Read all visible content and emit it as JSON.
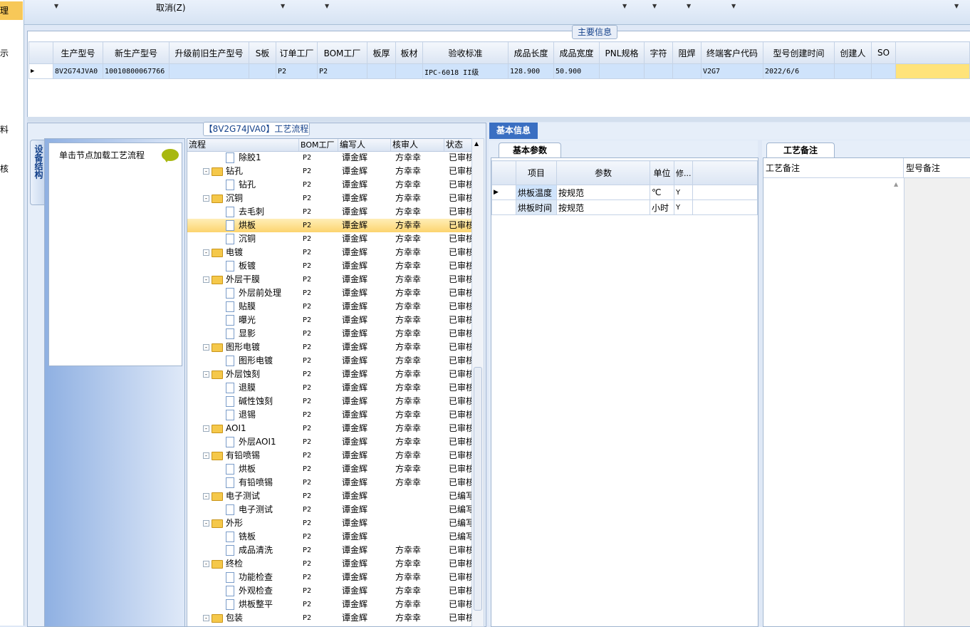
{
  "left_strip": {
    "items": [
      "理",
      "示",
      "料",
      "核"
    ]
  },
  "toolbar": {
    "cancel_label": "取消(Z)"
  },
  "main_info": {
    "title": "主要信息",
    "columns": [
      "生产型号",
      "新生产型号",
      "升级前旧生产型号",
      "S板",
      "订单工厂",
      "BOM工厂",
      "板厚",
      "板材",
      "验收标准",
      "成品长度",
      "成品宽度",
      "PNL规格",
      "字符",
      "阻焊",
      "终端客户代码",
      "型号创建时间",
      "创建人",
      "SO"
    ],
    "row": [
      "8V2G74JVA0",
      "10010800067766",
      "",
      "",
      "P2",
      "P2",
      "",
      "",
      "IPC-6018 II级",
      "128.900",
      "50.900",
      "",
      "",
      "",
      "V2G7",
      "2022/6/6",
      "",
      ""
    ]
  },
  "process": {
    "title": "【8V2G74JVA0】工艺流程",
    "vertical_tab": "设备结构",
    "node_hint": "单击节点加载工艺流程",
    "columns": [
      "流程",
      "BOM工厂",
      "编写人",
      "核审人",
      "状态"
    ],
    "rows": [
      {
        "name": "除胶1",
        "level": 2,
        "bom": "P2",
        "writer": "谭金辉",
        "reviewer": "方幸幸",
        "status": "已审核"
      },
      {
        "name": "钻孔",
        "level": 1,
        "bom": "P2",
        "writer": "谭金辉",
        "reviewer": "方幸幸",
        "status": "已审核"
      },
      {
        "name": "钻孔",
        "level": 2,
        "bom": "P2",
        "writer": "谭金辉",
        "reviewer": "方幸幸",
        "status": "已审核"
      },
      {
        "name": "沉铜",
        "level": 1,
        "bom": "P2",
        "writer": "谭金辉",
        "reviewer": "方幸幸",
        "status": "已审核"
      },
      {
        "name": "去毛刺",
        "level": 2,
        "bom": "P2",
        "writer": "谭金辉",
        "reviewer": "方幸幸",
        "status": "已审核"
      },
      {
        "name": "烘板",
        "level": 2,
        "bom": "P2",
        "writer": "谭金辉",
        "reviewer": "方幸幸",
        "status": "已审核",
        "selected": true
      },
      {
        "name": "沉铜",
        "level": 2,
        "bom": "P2",
        "writer": "谭金辉",
        "reviewer": "方幸幸",
        "status": "已审核"
      },
      {
        "name": "电镀",
        "level": 1,
        "bom": "P2",
        "writer": "谭金辉",
        "reviewer": "方幸幸",
        "status": "已审核"
      },
      {
        "name": "板镀",
        "level": 2,
        "bom": "P2",
        "writer": "谭金辉",
        "reviewer": "方幸幸",
        "status": "已审核"
      },
      {
        "name": "外层干膜",
        "level": 1,
        "bom": "P2",
        "writer": "谭金辉",
        "reviewer": "方幸幸",
        "status": "已审核"
      },
      {
        "name": "外层前处理",
        "level": 2,
        "bom": "P2",
        "writer": "谭金辉",
        "reviewer": "方幸幸",
        "status": "已审核"
      },
      {
        "name": "贴膜",
        "level": 2,
        "bom": "P2",
        "writer": "谭金辉",
        "reviewer": "方幸幸",
        "status": "已审核"
      },
      {
        "name": "曝光",
        "level": 2,
        "bom": "P2",
        "writer": "谭金辉",
        "reviewer": "方幸幸",
        "status": "已审核"
      },
      {
        "name": "显影",
        "level": 2,
        "bom": "P2",
        "writer": "谭金辉",
        "reviewer": "方幸幸",
        "status": "已审核"
      },
      {
        "name": "图形电镀",
        "level": 1,
        "bom": "P2",
        "writer": "谭金辉",
        "reviewer": "方幸幸",
        "status": "已审核"
      },
      {
        "name": "图形电镀",
        "level": 2,
        "bom": "P2",
        "writer": "谭金辉",
        "reviewer": "方幸幸",
        "status": "已审核"
      },
      {
        "name": "外层蚀刻",
        "level": 1,
        "bom": "P2",
        "writer": "谭金辉",
        "reviewer": "方幸幸",
        "status": "已审核"
      },
      {
        "name": "退膜",
        "level": 2,
        "bom": "P2",
        "writer": "谭金辉",
        "reviewer": "方幸幸",
        "status": "已审核"
      },
      {
        "name": "碱性蚀刻",
        "level": 2,
        "bom": "P2",
        "writer": "谭金辉",
        "reviewer": "方幸幸",
        "status": "已审核"
      },
      {
        "name": "退锡",
        "level": 2,
        "bom": "P2",
        "writer": "谭金辉",
        "reviewer": "方幸幸",
        "status": "已审核"
      },
      {
        "name": "AOI1",
        "level": 1,
        "bom": "P2",
        "writer": "谭金辉",
        "reviewer": "方幸幸",
        "status": "已审核"
      },
      {
        "name": "外层AOI1",
        "level": 2,
        "bom": "P2",
        "writer": "谭金辉",
        "reviewer": "方幸幸",
        "status": "已审核"
      },
      {
        "name": "有铅喷锡",
        "level": 1,
        "bom": "P2",
        "writer": "谭金辉",
        "reviewer": "方幸幸",
        "status": "已审核"
      },
      {
        "name": "烘板",
        "level": 2,
        "bom": "P2",
        "writer": "谭金辉",
        "reviewer": "方幸幸",
        "status": "已审核"
      },
      {
        "name": "有铅喷锡",
        "level": 2,
        "bom": "P2",
        "writer": "谭金辉",
        "reviewer": "方幸幸",
        "status": "已审核"
      },
      {
        "name": "电子测试",
        "level": 1,
        "bom": "P2",
        "writer": "谭金辉",
        "reviewer": "",
        "status": "已编写"
      },
      {
        "name": "电子测试",
        "level": 2,
        "bom": "P2",
        "writer": "谭金辉",
        "reviewer": "",
        "status": "已编写"
      },
      {
        "name": "外形",
        "level": 1,
        "bom": "P2",
        "writer": "谭金辉",
        "reviewer": "",
        "status": "已编写"
      },
      {
        "name": "铣板",
        "level": 2,
        "bom": "P2",
        "writer": "谭金辉",
        "reviewer": "",
        "status": "已编写"
      },
      {
        "name": "成品清洗",
        "level": 2,
        "bom": "P2",
        "writer": "谭金辉",
        "reviewer": "方幸幸",
        "status": "已审核"
      },
      {
        "name": "终检",
        "level": 1,
        "bom": "P2",
        "writer": "谭金辉",
        "reviewer": "方幸幸",
        "status": "已审核"
      },
      {
        "name": "功能检查",
        "level": 2,
        "bom": "P2",
        "writer": "谭金辉",
        "reviewer": "方幸幸",
        "status": "已审核"
      },
      {
        "name": "外观检查",
        "level": 2,
        "bom": "P2",
        "writer": "谭金辉",
        "reviewer": "方幸幸",
        "status": "已审核"
      },
      {
        "name": "烘板整平",
        "level": 2,
        "bom": "P2",
        "writer": "谭金辉",
        "reviewer": "方幸幸",
        "status": "已审核"
      },
      {
        "name": "包装",
        "level": 1,
        "bom": "P2",
        "writer": "谭金辉",
        "reviewer": "方幸幸",
        "status": "已审核"
      }
    ]
  },
  "basic_info": {
    "tab": "基本信息",
    "param_tab": "基本参数",
    "columns": [
      "项目",
      "参数",
      "单位",
      "修..."
    ],
    "rows": [
      {
        "item": "烘板温度",
        "param": "按规范",
        "unit": "℃",
        "mod": "Y"
      },
      {
        "item": "烘板时间",
        "param": "按规范",
        "unit": "小时",
        "mod": "Y"
      }
    ]
  },
  "remarks": {
    "tab": "工艺备注",
    "col1": "工艺备注",
    "col2": "型号备注"
  },
  "colors": {
    "selection": "#fcd46e",
    "tab_active": "#3a6fc2",
    "row_selected": "#cfe3fb"
  }
}
